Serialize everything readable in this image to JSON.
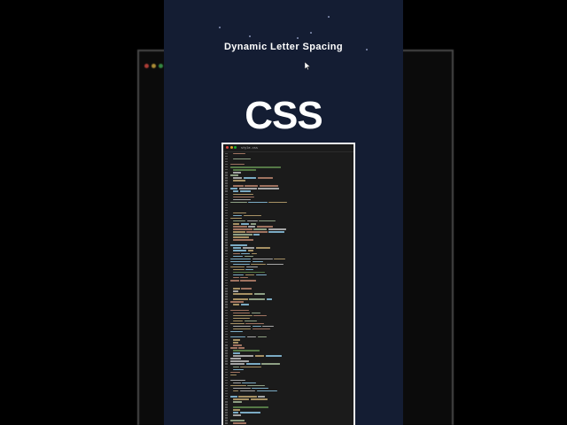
{
  "title": "Dynamic Letter Spacing",
  "big_label": "CSS",
  "editor": {
    "tab_label": "style.css",
    "colors": {
      "panel_bg": "#141d33",
      "editor_bg": "#1b1b1b",
      "keyword": "#d7ba7d",
      "property": "#9cdcfe",
      "value": "#ce9178",
      "comment": "#6a9955",
      "number": "#b5cea8",
      "punct": "#d4d4d4"
    },
    "icons": [
      "window-close-dot-icon",
      "window-minimize-dot-icon",
      "window-maximize-dot-icon",
      "cursor-arrow-icon"
    ]
  }
}
